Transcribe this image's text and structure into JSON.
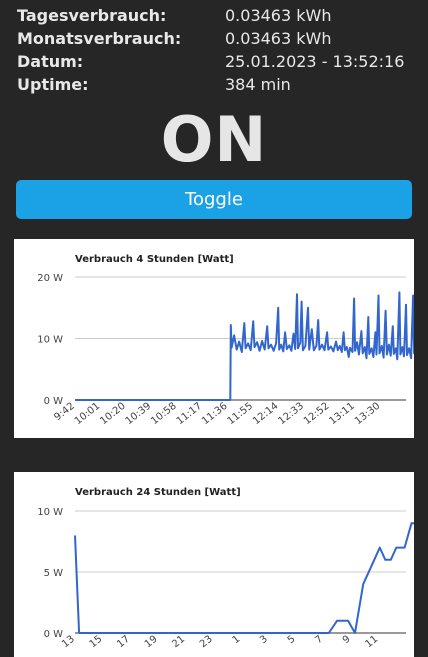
{
  "stats": [
    {
      "label": "Tagesverbrauch:",
      "value": "0.03463 kWh"
    },
    {
      "label": "Monatsverbrauch:",
      "value": "0.03463 kWh"
    },
    {
      "label": "Datum:",
      "value": "25.01.2023 - 13:52:16"
    },
    {
      "label": "Uptime:",
      "value": "384 min"
    }
  ],
  "state": "ON",
  "toggle_label": "Toggle",
  "chart_data": [
    {
      "type": "line",
      "title": "Verbrauch 4 Stunden [Watt]",
      "xlabel": "",
      "ylabel": "",
      "y_ticks": [
        "0 W",
        "10 W",
        "20 W"
      ],
      "ylim": [
        0,
        20
      ],
      "x_ticks": [
        "9:42",
        "10:01",
        "10:20",
        "10:39",
        "10:58",
        "11:17",
        "11:36",
        "11:55",
        "12:14",
        "12:33",
        "12:52",
        "13:11",
        "13:30"
      ],
      "series_color": "#3366cc",
      "grid": true,
      "series": [
        {
          "values": [
            [
              0,
              0
            ],
            [
              6.1,
              0
            ],
            [
              6.12,
              12.2
            ],
            [
              6.15,
              8.5
            ],
            [
              6.25,
              10.5
            ],
            [
              6.35,
              8.2
            ],
            [
              6.45,
              9.5
            ],
            [
              6.55,
              7.8
            ],
            [
              6.65,
              12.5
            ],
            [
              6.7,
              8.4
            ],
            [
              6.8,
              9.2
            ],
            [
              6.9,
              8.1
            ],
            [
              7.0,
              12.8
            ],
            [
              7.05,
              8.6
            ],
            [
              7.15,
              9.4
            ],
            [
              7.25,
              8.0
            ],
            [
              7.35,
              9.6
            ],
            [
              7.45,
              8.2
            ],
            [
              7.55,
              12.0
            ],
            [
              7.6,
              8.4
            ],
            [
              7.7,
              9.0
            ],
            [
              7.8,
              8.0
            ],
            [
              7.9,
              9.2
            ],
            [
              7.98,
              15.0
            ],
            [
              8.02,
              8.2
            ],
            [
              8.1,
              9.0
            ],
            [
              8.18,
              7.9
            ],
            [
              8.25,
              11.0
            ],
            [
              8.32,
              8.3
            ],
            [
              8.42,
              8.9
            ],
            [
              8.5,
              8.0
            ],
            [
              8.58,
              10.8
            ],
            [
              8.65,
              8.3
            ],
            [
              8.72,
              17.2
            ],
            [
              8.76,
              8.4
            ],
            [
              8.85,
              9.3
            ],
            [
              8.9,
              16.0
            ],
            [
              8.95,
              8.1
            ],
            [
              9.05,
              8.8
            ],
            [
              9.15,
              15.0
            ],
            [
              9.2,
              8.2
            ],
            [
              9.3,
              11.5
            ],
            [
              9.38,
              8.1
            ],
            [
              9.48,
              8.8
            ],
            [
              9.55,
              13.0
            ],
            [
              9.6,
              8.2
            ],
            [
              9.7,
              9.0
            ],
            [
              9.8,
              8.1
            ],
            [
              9.9,
              11.0
            ],
            [
              9.95,
              8.2
            ],
            [
              10.05,
              8.7
            ],
            [
              10.15,
              7.9
            ],
            [
              10.25,
              9.5
            ],
            [
              10.32,
              8.1
            ],
            [
              10.4,
              8.8
            ],
            [
              10.48,
              7.8
            ],
            [
              10.55,
              11.0
            ],
            [
              10.6,
              8.1
            ],
            [
              10.68,
              8.6
            ],
            [
              10.75,
              7.0
            ],
            [
              10.8,
              8.5
            ],
            [
              10.9,
              7.8
            ],
            [
              10.96,
              16.5
            ],
            [
              11.0,
              8.0
            ],
            [
              11.08,
              9.4
            ],
            [
              11.15,
              7.4
            ],
            [
              11.25,
              11.2
            ],
            [
              11.3,
              7.6
            ],
            [
              11.38,
              8.6
            ],
            [
              11.45,
              6.8
            ],
            [
              11.52,
              13.5
            ],
            [
              11.56,
              7.5
            ],
            [
              11.65,
              8.4
            ],
            [
              11.72,
              7.0
            ],
            [
              11.8,
              11.0
            ],
            [
              11.84,
              7.4
            ],
            [
              11.92,
              17.0
            ],
            [
              11.96,
              7.6
            ],
            [
              12.05,
              8.8
            ],
            [
              12.12,
              6.9
            ],
            [
              12.2,
              14.5
            ],
            [
              12.25,
              7.4
            ],
            [
              12.33,
              9.0
            ],
            [
              12.4,
              7.2
            ],
            [
              12.48,
              12.0
            ],
            [
              12.52,
              7.5
            ],
            [
              12.6,
              8.4
            ],
            [
              12.66,
              6.6
            ],
            [
              12.74,
              17.5
            ],
            [
              12.78,
              7.4
            ],
            [
              12.86,
              8.6
            ],
            [
              12.92,
              7.1
            ],
            [
              13.0,
              15.5
            ],
            [
              13.04,
              7.3
            ],
            [
              13.12,
              8.4
            ],
            [
              13.2,
              6.8
            ],
            [
              13.28,
              17.0
            ],
            [
              13.32,
              7.6
            ],
            [
              13.4,
              8.8
            ],
            [
              13.46,
              7.0
            ],
            [
              13.54,
              17.2
            ],
            [
              13.58,
              7.8
            ],
            [
              13.62,
              8.2
            ]
          ]
        }
      ]
    },
    {
      "type": "line",
      "title": "Verbrauch 24 Stunden [Watt]",
      "xlabel": "",
      "ylabel": "",
      "y_ticks": [
        "0 W",
        "5 W",
        "10 W"
      ],
      "ylim": [
        0,
        10
      ],
      "x_ticks": [
        "13",
        "15",
        "17",
        "19",
        "21",
        "23",
        "1",
        "3",
        "5",
        "7",
        "9",
        "11"
      ],
      "series_color": "#3366cc",
      "grid": true,
      "series": [
        {
          "values": [
            [
              0,
              8
            ],
            [
              0.15,
              0
            ],
            [
              9.2,
              0
            ],
            [
              9.5,
              1
            ],
            [
              9.9,
              1
            ],
            [
              10.15,
              0
            ],
            [
              10.45,
              4
            ],
            [
              10.75,
              5.5
            ],
            [
              11.05,
              7
            ],
            [
              11.25,
              6
            ],
            [
              11.45,
              6
            ],
            [
              11.65,
              7
            ],
            [
              11.95,
              7
            ],
            [
              12.2,
              9
            ],
            [
              12.45,
              9
            ],
            [
              12.65,
              8
            ],
            [
              12.9,
              8
            ]
          ]
        }
      ]
    }
  ]
}
